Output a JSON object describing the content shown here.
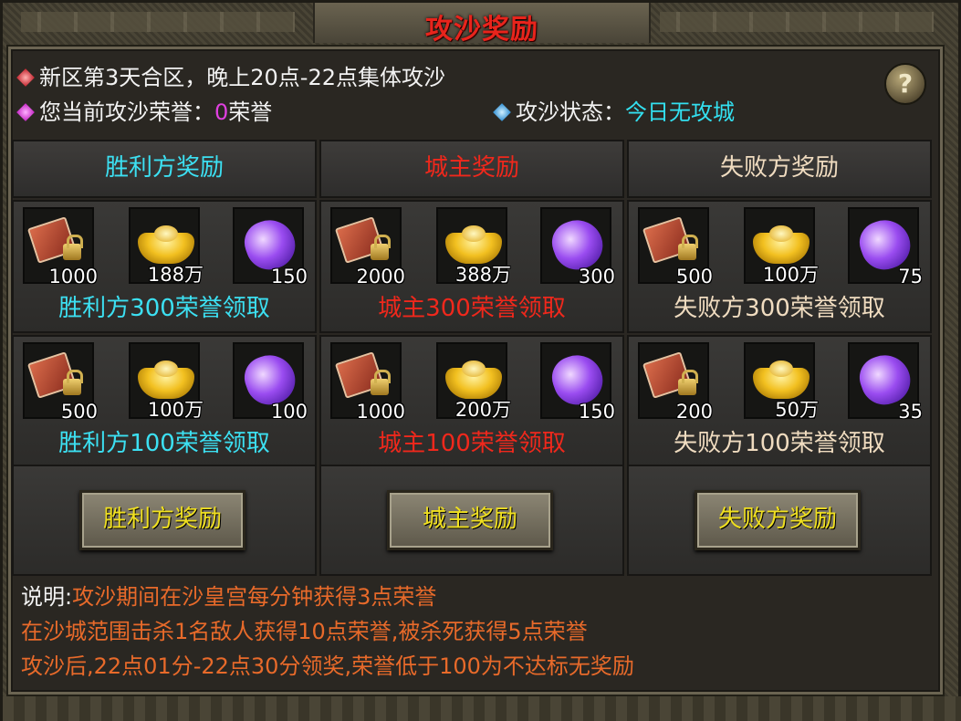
{
  "window": {
    "title": "攻沙奖励"
  },
  "info": {
    "line1": "新区第3天合区，晚上20点-22点集体攻沙",
    "honor_label": "您当前攻沙荣誉：",
    "honor_value": "0",
    "honor_unit": "荣誉",
    "status_label": "攻沙状态：",
    "status_value": "今日无攻城",
    "help_label": "?"
  },
  "columns": [
    {
      "header": "胜利方奖励",
      "color": "#3ce0f2",
      "tiers": [
        {
          "qty": [
            "1000",
            "188万",
            "150"
          ],
          "label": "胜利方300荣誉领取"
        },
        {
          "qty": [
            "500",
            "100万",
            "100"
          ],
          "label": "胜利方100荣誉领取"
        }
      ],
      "button": "胜利方奖励"
    },
    {
      "header": "城主奖励",
      "color": "#f0281c",
      "tiers": [
        {
          "qty": [
            "2000",
            "388万",
            "300"
          ],
          "label": "城主300荣誉领取"
        },
        {
          "qty": [
            "1000",
            "200万",
            "150"
          ],
          "label": "城主100荣誉领取"
        }
      ],
      "button": "城主奖励"
    },
    {
      "header": "失败方奖励",
      "color": "#f0dcc0",
      "tiers": [
        {
          "qty": [
            "500",
            "100万",
            "75"
          ],
          "label": "失败方300荣誉领取"
        },
        {
          "qty": [
            "200",
            "50万",
            "35"
          ],
          "label": "失败方100荣誉领取"
        }
      ],
      "button": "失败方奖励"
    }
  ],
  "icons": [
    "skill-book-icon",
    "gold-ingot-icon",
    "purple-gem-icon"
  ],
  "description": {
    "prefix": "说明:",
    "line1": "攻沙期间在沙皇宫每分钟获得3点荣誉",
    "line2": "在沙城范围击杀1名敌人获得10点荣誉,被杀死获得5点荣誉",
    "line3": "攻沙后,22点01分-22点30分领奖,荣誉低于100为不达标无奖励"
  }
}
